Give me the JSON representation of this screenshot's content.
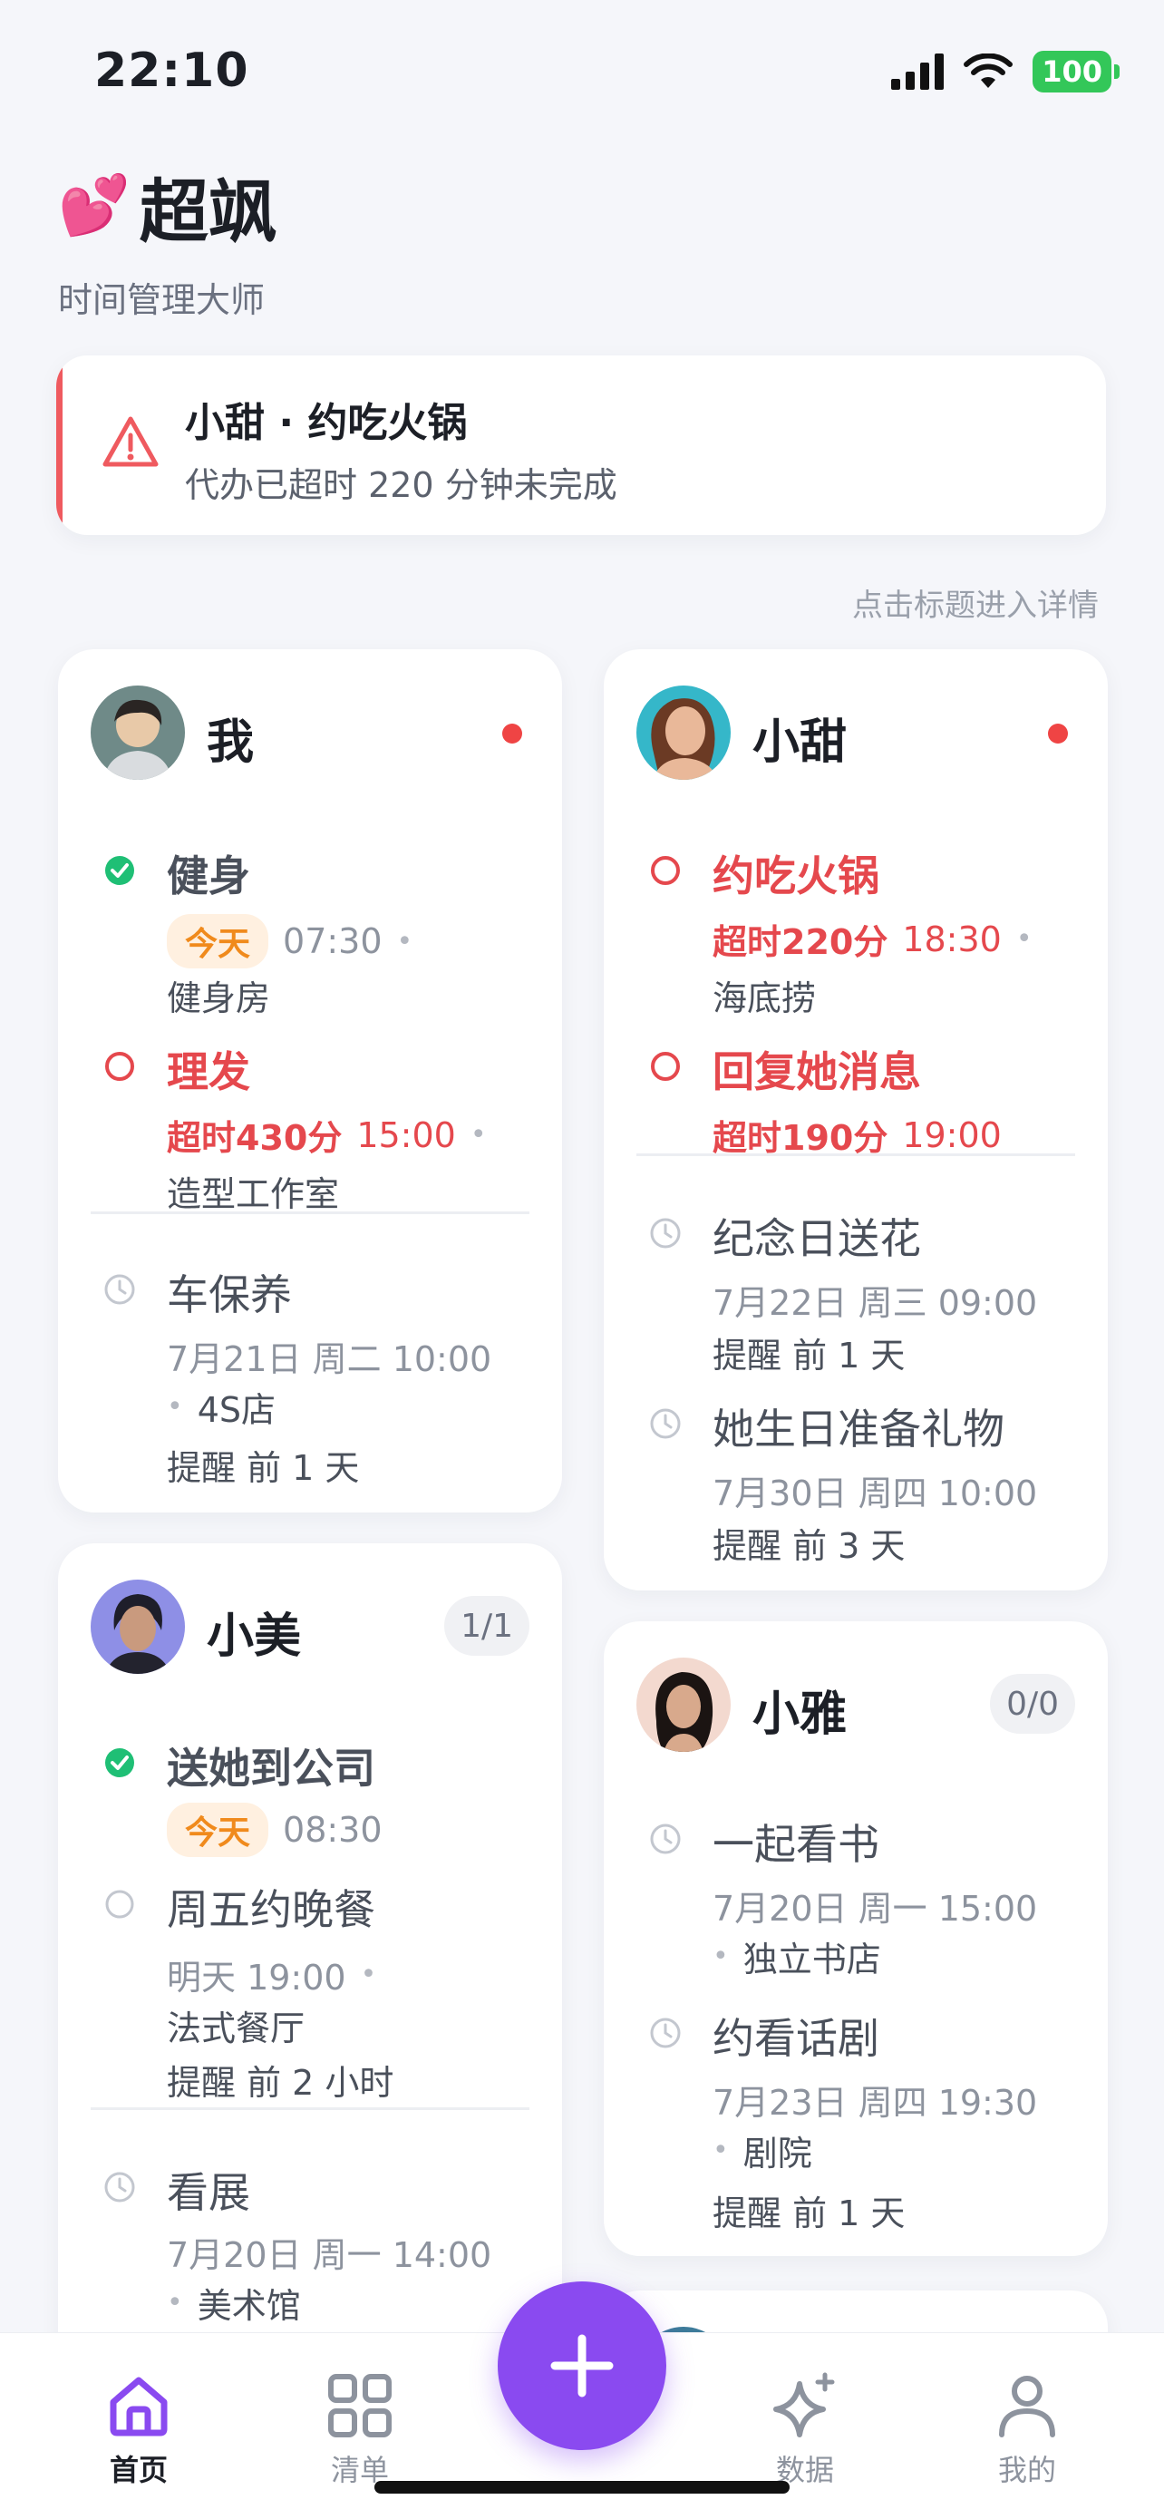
{
  "status_bar": {
    "time": "22:10",
    "battery": "100"
  },
  "header": {
    "emoji": "💕",
    "title": "超飒",
    "subtitle": "时间管理大师"
  },
  "alert": {
    "title": "小甜 · 约吃火锅",
    "message": "代办已超时 220 分钟未完成"
  },
  "hint": "点击标题进入详情",
  "cards": {
    "me": {
      "name": "我",
      "tasks": [
        {
          "title": "健身",
          "badge": "今天",
          "time": "07:30",
          "location": "健身房"
        },
        {
          "title": "理发",
          "overdue": "超时430分",
          "time": "15:00",
          "location": "造型工作室"
        }
      ],
      "upcoming": [
        {
          "title": "车保养",
          "datetime": "7月21日 周二 10:00",
          "location": "4S店",
          "reminder": "提醒 前 1 天"
        }
      ]
    },
    "xiaotian": {
      "name": "小甜",
      "tasks": [
        {
          "title": "约吃火锅",
          "overdue": "超时220分",
          "time": "18:30",
          "location": "海底捞"
        },
        {
          "title": "回复她消息",
          "overdue": "超时190分",
          "time": "19:00"
        }
      ],
      "upcoming": [
        {
          "title": "纪念日送花",
          "datetime": "7月22日 周三 09:00",
          "reminder": "提醒 前 1 天"
        },
        {
          "title": "她生日准备礼物",
          "datetime": "7月30日 周四 10:00",
          "reminder": "提醒 前 3 天"
        }
      ]
    },
    "xiaomei": {
      "name": "小美",
      "count": "1/1",
      "tasks": [
        {
          "title": "送她到公司",
          "badge": "今天",
          "time": "08:30"
        },
        {
          "title": "周五约晚餐",
          "datetime": "明天 19:00",
          "location": "法式餐厅",
          "reminder": "提醒 前 2 小时"
        }
      ],
      "upcoming": [
        {
          "title": "看展",
          "datetime": "7月20日 周一 14:00",
          "location": "美术馆"
        }
      ]
    },
    "xiaoya": {
      "name": "小雅",
      "count": "0/0",
      "upcoming": [
        {
          "title": "一起看书",
          "datetime": "7月20日 周一 15:00",
          "location": "独立书店"
        },
        {
          "title": "约看话剧",
          "datetime": "7月23日 周四 19:30",
          "location": "剧院",
          "reminder": "提醒 前 1 天"
        }
      ]
    }
  },
  "nav": {
    "home": "首页",
    "list": "清单",
    "data": "数据",
    "mine": "我的"
  },
  "colors": {
    "accent": "#8a4af0",
    "overdue": "#e5484d",
    "done": "#1fbf75",
    "alert_bar": "#ef5a5f",
    "today_badge": "#f08a1c"
  }
}
